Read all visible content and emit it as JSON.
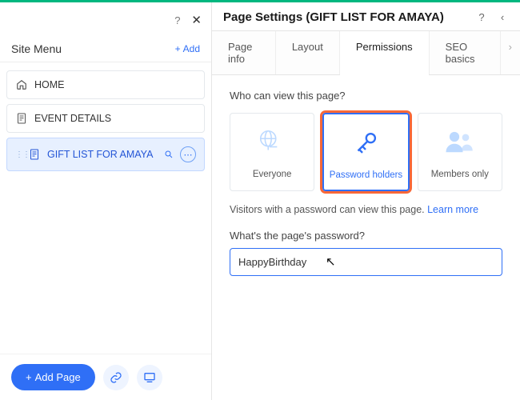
{
  "sidebar": {
    "title": "Site Menu",
    "add_label": "Add",
    "items": [
      {
        "label": "HOME"
      },
      {
        "label": "EVENT DETAILS"
      },
      {
        "label": "GIFT LIST FOR AMAYA"
      }
    ],
    "add_page_label": "Add Page"
  },
  "main": {
    "title": "Page Settings (GIFT LIST FOR AMAYA)",
    "tabs": [
      {
        "label": "Page info"
      },
      {
        "label": "Layout"
      },
      {
        "label": "Permissions"
      },
      {
        "label": "SEO basics"
      }
    ],
    "active_tab_index": 2,
    "q1": "Who can view this page?",
    "choices": [
      {
        "label": "Everyone"
      },
      {
        "label": "Password holders"
      },
      {
        "label": "Members only"
      }
    ],
    "selected_choice_index": 1,
    "desc_text": "Visitors with a password can view this page. ",
    "learn_more": "Learn more",
    "q2": "What's the page's password?",
    "password_value": "HappyBirthday"
  },
  "colors": {
    "accent": "#2f6ff6",
    "highlight": "#f86838",
    "topbar": "#00b77f"
  }
}
